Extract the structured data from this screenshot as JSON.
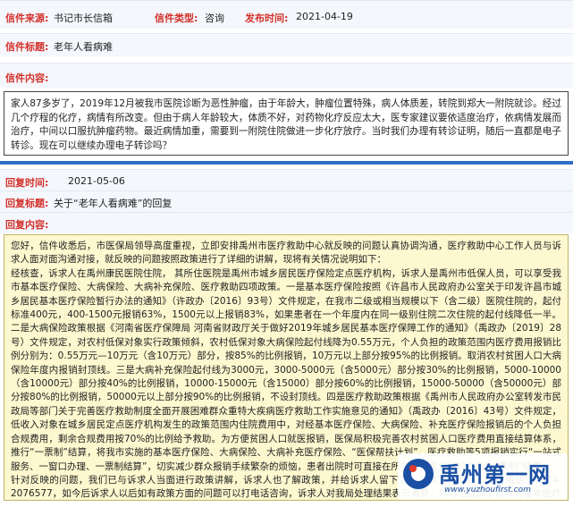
{
  "letter": {
    "source_label": "信件来源:",
    "source_value": "书记市长信箱",
    "type_label": "信件类型:",
    "type_value": "咨询",
    "time_label": "发布时间:",
    "time_value": "2021-04-19",
    "title_label": "信件标题:",
    "title_value": "老年人看病难",
    "content_label": "信件内容:",
    "content": "家人87多岁了，2019年12月被我市医院诊断为恶性肿瘤，由于年龄大，肿瘤位置特殊，病人体质差，转院到郑大一附院就诊。经过几个疗程的化疗，病情有所改变。但由于病人年龄较大，体质不好，对药物化疗反应太大，医专家建议要依适度治疗，依病情发展而治疗，中间以口服抗肿瘤药物。最近病情加重，需要到一附院住院做进一步化疗放疗。当时我们办理有转诊证明，随后一直都是电子转诊。现在可以继续办理电子转诊吗？"
  },
  "reply": {
    "time_label": "回复时间:",
    "time_value": "2021-05-06",
    "title_label": "回复标题:",
    "title_value": "关于“老年人看病难”的回复",
    "content_label": "回复内容:",
    "paragraphs": [
      "您好，信件收悉后，市医保局领导高度重视，立即安排禹州市医疗救助中心就反映的问题认真协调沟通，医疗救助中心工作人员与诉求人面对面沟通对接，就反映的问题按照政策进行了详细的讲解，现将有关情况说明如下：",
      "经核查，诉求人在禹州康民医院住院， 其所住医院是禹州市城乡居民医疗保险定点医疗机构，诉求人是禹州市低保人员，可以享受我市基本医疗保险、大病保险、大病补充保险、医疗救助四项政策。一是基本医疗保险按照《许昌市人民政府办公室关于印发许昌市城乡居民基本医疗保险暂行办法的通知》（许政办〔2016〕93号）文件规定，在我市二级或相当规模以下（含二级）医院住院的，起付标准400元，400-1500元报销63%，1500元以上报销83%，如果患者在一个年度内在同一级别住院二次住院的起付线降低一半。二是大病保险政策根据《河南省医疗保障局 河南省财政厅关于做好2019年城乡居民基本医疗保障工作的通知》（禹政办〔2019〕28号）文件规定，对农村低保对象实行政策倾斜，农村低保对象大病保险起付线降为0.55万元，个人负担的政策范围内医疗费用报销比例分别为：0.55万元—10万元（含10万元）部分，按85%的比例报销，10万元以上部分按95%的比例报销。取消农村贫困人口大病保险年度内报销封顶线。三是大病补充保险起付线为3000元，3000-5000元（含5000元）部分按30%的比例报销，5000-10000（含10000元）部分按40%的比例报销，10000-15000元（含15000）部分按60%的比例报销，15000-50000（含50000元）部分按80%的比例报销，50000元以上部分按90%的比例报销，不设封顶线。四是医疗救助政策根据《禹州市人民政府办公室转发市民政局等部门关于完善医疗救助制度全面开展困难群众重特大疾病医疗救助工作实施意见的通知》（禹政办〔2016〕43号）文件规定，低收入对象在城乡居民定点医疗机构发生的政策范围内住院费用中，对经基本医疗保险、大病保险、补充医疗保险报销后的个人负担合规费用，剩余合规费用按70%的比例给予救助。为方便贫困人口就医报销，医保局积极完善农村贫困人口医疗费用直接结算体系，推行“一票制”结算，将我市实施的基本医疗保险、大病保险、大病补充医疗保险、“医保帮扶计划”、医疗救助等5项报销实行“一站式服务、一窗口办理、一票制结算”，切实减少群众报销手续繁杂的烦恼，患者出院时可直接在所在医院医保窗口办理“一票制”结算。",
      "针对反映的问题，我们已与诉求人当面进行政策讲解，诉求人也了解政策，并给诉求人留下了相关科室的电话，咨询电话：0374-2076577，如今后诉求人以后如有政策方面的问题可以打电话咨询，诉求人对我局处理结果表示满意，同时也提高了群众对基本医疗保险政策的宣传力度，提高群众对医疗保险政策的知晓率。"
    ]
  },
  "watermark": {
    "title": "禹州第一网",
    "url": "www.yuzhoufirst.com"
  },
  "colors": {
    "label_red": "#d3302a",
    "row_bg": "#f4f7fc",
    "divider_blue": "#2d6ec6",
    "reply_bg": "#fdf8cf",
    "brand_blue": "#1a4fa3"
  }
}
